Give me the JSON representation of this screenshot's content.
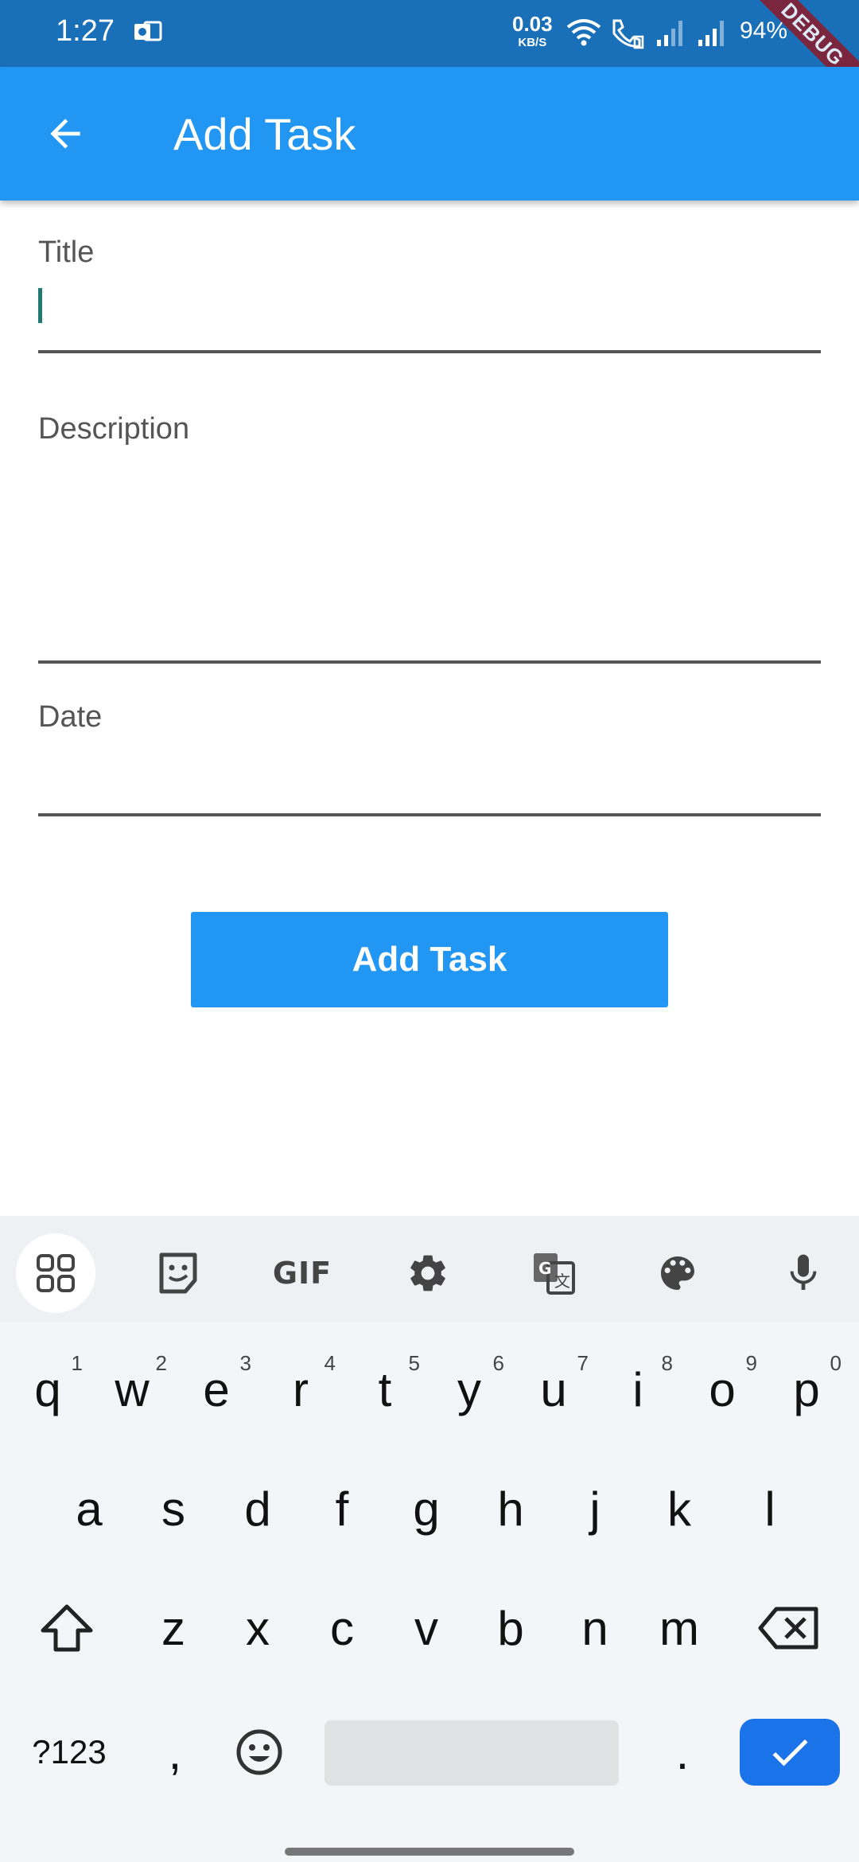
{
  "status_bar": {
    "time": "1:27",
    "speed_value": "0.03",
    "speed_unit": "KB/S",
    "battery": "94%"
  },
  "debug_banner": "DEBUG",
  "app_bar": {
    "title": "Add Task",
    "back_icon": "arrow-back-icon"
  },
  "form": {
    "title_label": "Title",
    "title_value": "",
    "description_label": "Description",
    "description_value": "",
    "date_label": "Date",
    "date_value": "",
    "submit_label": "Add Task"
  },
  "keyboard": {
    "toolbar": [
      "apps-icon",
      "sticker-icon",
      "GIF",
      "settings-icon",
      "translate-icon",
      "palette-icon",
      "mic-icon"
    ],
    "gif_label": "GIF",
    "row1": [
      {
        "key": "q",
        "hint": "1"
      },
      {
        "key": "w",
        "hint": "2"
      },
      {
        "key": "e",
        "hint": "3"
      },
      {
        "key": "r",
        "hint": "4"
      },
      {
        "key": "t",
        "hint": "5"
      },
      {
        "key": "y",
        "hint": "6"
      },
      {
        "key": "u",
        "hint": "7"
      },
      {
        "key": "i",
        "hint": "8"
      },
      {
        "key": "o",
        "hint": "9"
      },
      {
        "key": "p",
        "hint": "0"
      }
    ],
    "row2": [
      "a",
      "s",
      "d",
      "f",
      "g",
      "h",
      "j",
      "k",
      "l"
    ],
    "row3": [
      "z",
      "x",
      "c",
      "v",
      "b",
      "n",
      "m"
    ],
    "symbols_label": "?123",
    "comma": ",",
    "period": ".",
    "accent_color": "#1a73e8"
  },
  "colors": {
    "status_bar": "#1a70b8",
    "app_bar": "#2196f3",
    "button": "#2196f3"
  }
}
